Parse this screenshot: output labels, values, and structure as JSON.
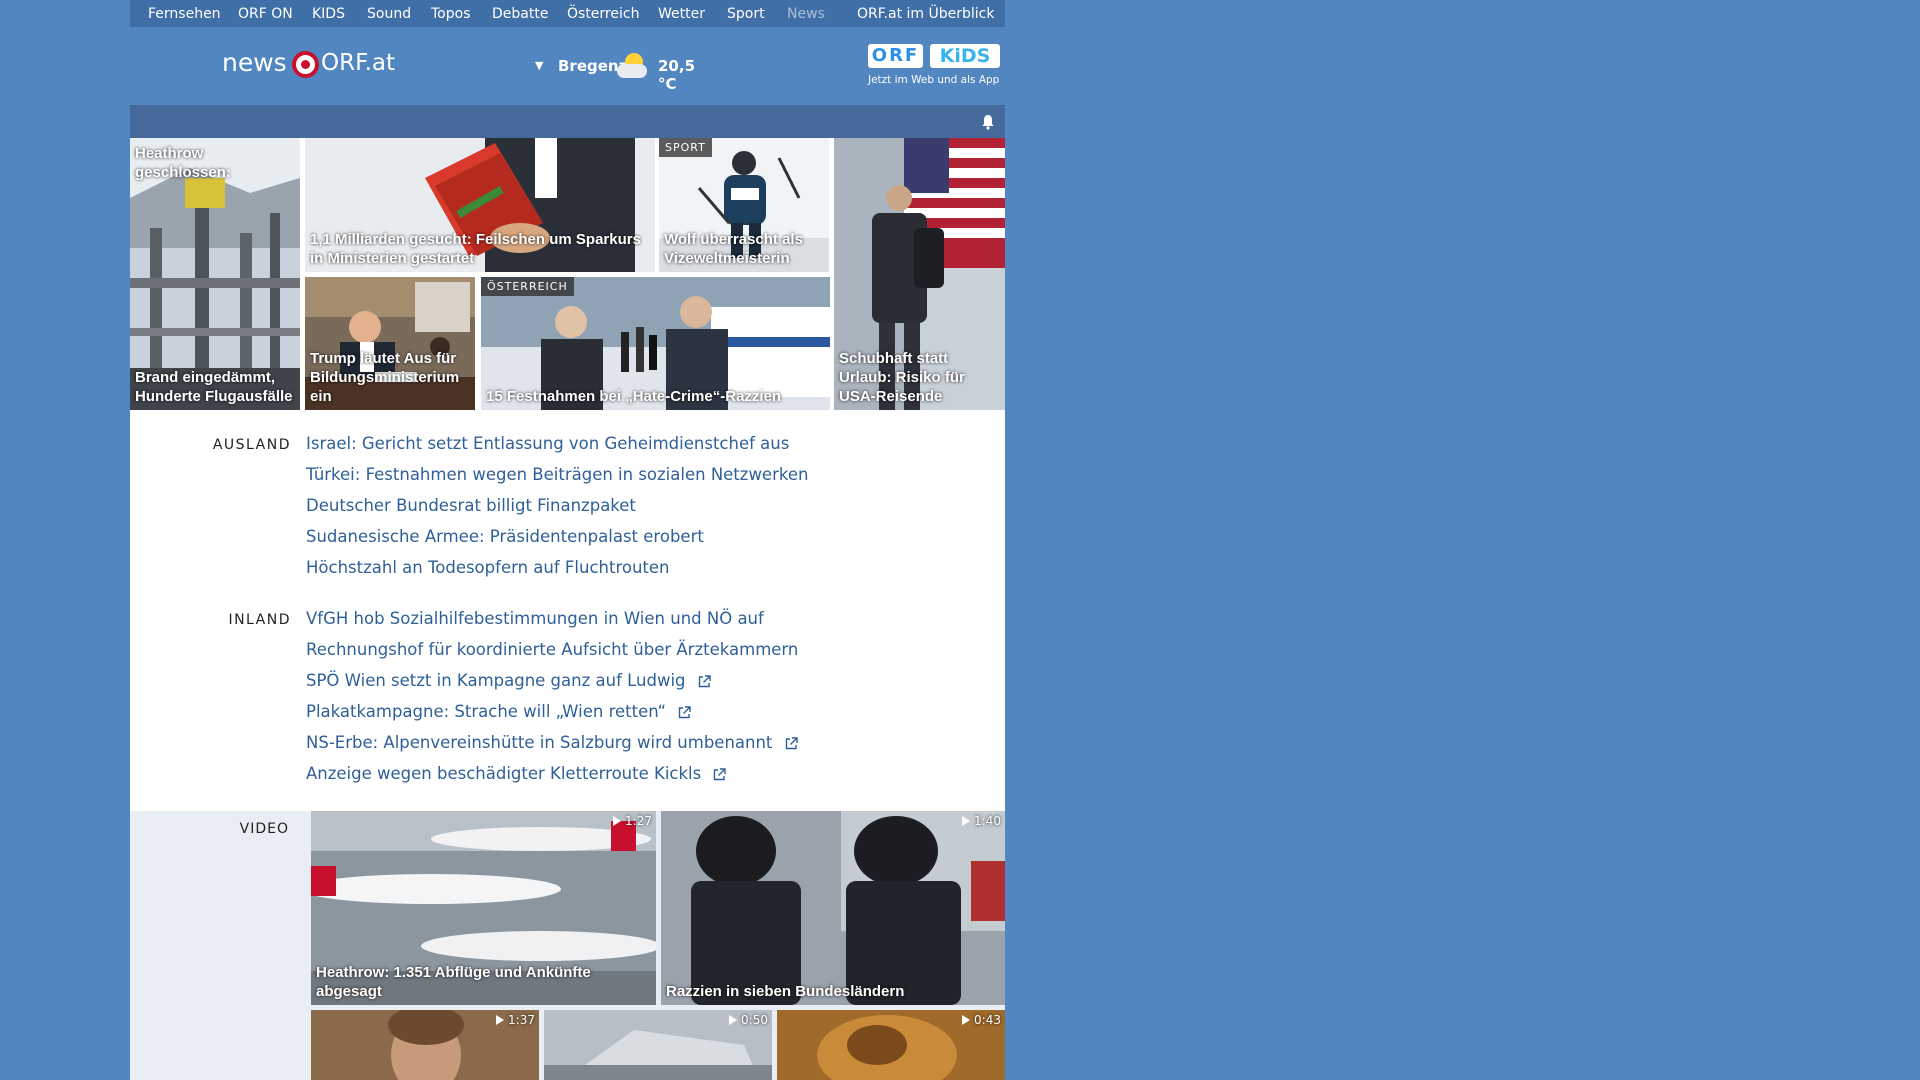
{
  "topnav": {
    "items": [
      "Fernsehen",
      "ORF ON",
      "KIDS",
      "Sound",
      "Topos",
      "Debatte",
      "Österreich",
      "Wetter",
      "Sport",
      "News",
      "ORF.at im Überblick"
    ]
  },
  "header": {
    "logo_news": "news",
    "logo_orf": "ORF.at",
    "weather_city": "Bregenz",
    "weather_temp": "20,5 °C",
    "weather_icon": "sun-cloud-icon",
    "kids_orf": "ORF",
    "kids_label": "KiDS",
    "kids_tagline": "Jetzt im Web und als App"
  },
  "teasers": [
    {
      "caption_top": "Heathrow geschlossen:",
      "caption": "Brand eingedämmt, Hunderte Flugausfälle"
    },
    {
      "caption": "1,1 Milliarden gesucht: Feilschen um Sparkurs in Ministerien gestartet"
    },
    {
      "badge": "SPORT",
      "caption": "Wolf überrascht als Vizeweltmeisterin"
    },
    {
      "caption": "Schubhaft statt Urlaub: Risiko für USA-Reisende"
    },
    {
      "caption": "Trump läutet Aus für Bildungsministerium ein"
    },
    {
      "badge": "ÖSTERREICH",
      "caption": "15 Festnahmen bei „Hate-Crime“-Razzien"
    }
  ],
  "ausland": {
    "label": "AUSLAND",
    "items": [
      "Israel: Gericht setzt Entlassung von Geheimdienstchef aus",
      "Türkei: Festnahmen wegen Beiträgen in sozialen Netzwerken",
      "Deutscher Bundesrat billigt Finanzpaket",
      "Sudanesische Armee: Präsidentenpalast erobert",
      "Höchstzahl an Todesopfern auf Fluchtrouten"
    ]
  },
  "inland": {
    "label": "INLAND",
    "items": [
      "VfGH hob Sozialhilfebestimmungen in Wien und NÖ auf",
      "Rechnungshof für koordinierte Aufsicht über Ärztekammern",
      "SPÖ Wien setzt in Kampagne ganz auf Ludwig",
      "Plakatkampagne: Strache will „Wien retten“",
      "NS-Erbe: Alpenvereinshütte in Salzburg wird umbenannt",
      "Anzeige wegen beschädigter Kletterroute Kickls"
    ]
  },
  "video": {
    "label": "VIDEO",
    "items": [
      {
        "duration": "1:27",
        "caption": "Heathrow: 1.351 Abflüge und Ankünfte abgesagt"
      },
      {
        "duration": "1:40",
        "caption": "Razzien in sieben Bundesländern"
      },
      {
        "duration": "1:37"
      },
      {
        "duration": "0:50"
      },
      {
        "duration": "0:43"
      }
    ]
  },
  "colors": {
    "background": "#5286c0",
    "nav_bar": "#3f6fa6",
    "notify_bar": "#44699a",
    "link": "#2f5f98",
    "orf_red": "#c8102e"
  }
}
